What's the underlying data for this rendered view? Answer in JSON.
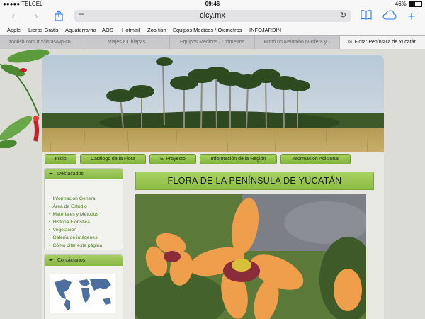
{
  "status": {
    "carrier": "●●●●● TELCEL",
    "time": "09:46",
    "battery": "46%",
    "battery_level": 0.46
  },
  "toolbar": {
    "url": "cicy.mx"
  },
  "bookmarks": [
    "Apple",
    "Libros Gratis",
    "Aquaterrarria",
    "AOS",
    "Hotmail",
    "Zoo fish",
    "Equipos Medicos / Oximetros",
    "INFOJARDIN"
  ],
  "tabs": [
    {
      "label": "zoofish.com.mx/listas/wp-co...",
      "active": false
    },
    {
      "label": "Viajes a Chiapas",
      "active": false
    },
    {
      "label": "Equipos Medicos / Oximetros",
      "active": false
    },
    {
      "label": "Brotó un Nelumbo nucifera y...",
      "active": false
    },
    {
      "label": "Flora: Península de Yucatán",
      "active": true
    }
  ],
  "nav": [
    "Inicio",
    "Catálogo de la Flora",
    "El Proyecto",
    "Información de la Región",
    "Información Adicional"
  ],
  "sidebar": {
    "destacados": {
      "title": "Destacados",
      "items": [
        "Información General",
        "Área de Estudio",
        "Materiales y Métodos",
        "Historia Florística",
        "Vegetación",
        "Galería de imágenes",
        "Cómo citar ésta página"
      ]
    },
    "contactanos": {
      "title": "Contáctanos"
    }
  },
  "main": {
    "title": "FLORA DE LA PENÍNSULA DE YUCATÁN"
  },
  "colors": {
    "accent": "#2f7cf6",
    "nav_green": "#8cbd45",
    "link_green": "#4d7a1c"
  }
}
